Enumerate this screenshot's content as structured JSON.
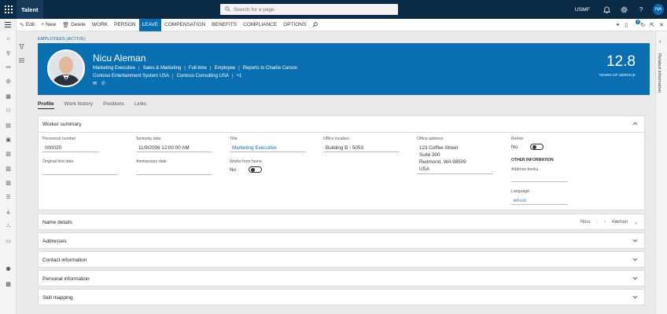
{
  "topbar": {
    "app_name": "Talent",
    "search_placeholder": "Search for a page",
    "company": "USMF",
    "user_initials": "NA"
  },
  "actionbar": {
    "edit": "Edit",
    "new": "New",
    "delete": "Delete",
    "tabs": [
      "WORK",
      "PERSON",
      "LEAVE",
      "COMPENSATION",
      "BENEFITS",
      "COMPLIANCE",
      "OPTIONS"
    ],
    "selected_tab": "LEAVE",
    "notification_count": "0"
  },
  "page": {
    "caption": "EMPLOYEES (ACTIVE)"
  },
  "hero": {
    "name": "Nicu Aleman",
    "line1": [
      "Marketing Executive",
      "Sales & Marketing",
      "Full-time",
      "Employee",
      "Reports to Charlie Carson"
    ],
    "line2": [
      "Contoso Entertainment System USA",
      "Contoso Consulting USA",
      "+1"
    ],
    "years_of_service": "12.8",
    "years_label": "YEARS OF SERVICE"
  },
  "tabs": [
    "Profile",
    "Work history",
    "Positions",
    "Links"
  ],
  "worker_summary": {
    "title": "Worker summary",
    "personnel_number_label": "Personnel number",
    "personnel_number": "000020",
    "seniority_date_label": "Seniority date",
    "seniority_date": "11/9/2006 12:00:00 AM",
    "title_label": "Title",
    "title_value": "Marketing Executive",
    "office_location_label": "Office location",
    "office_location": "Building B - 5053",
    "office_address_label": "Office address",
    "office_address": [
      "123 Coffee Street",
      "Suite 300",
      "Redmond, WA 98509",
      "USA"
    ],
    "rehire_label": "Rehire",
    "rehire_value": "No",
    "original_hire_label": "Original hire date",
    "anniversary_label": "Anniversary date",
    "works_from_home_label": "Works from home",
    "works_from_home_value": "No",
    "other_info_label": "OTHER INFORMATION",
    "address_books_label": "Address books",
    "language_label": "Language",
    "language_value": "en-us"
  },
  "name_details": {
    "title": "Name details",
    "first": "Nicu",
    "last": "Aleman"
  },
  "sections": [
    "Addresses",
    "Contact information",
    "Personal information",
    "Skill mapping"
  ],
  "right_panel": {
    "label": "Related information"
  }
}
